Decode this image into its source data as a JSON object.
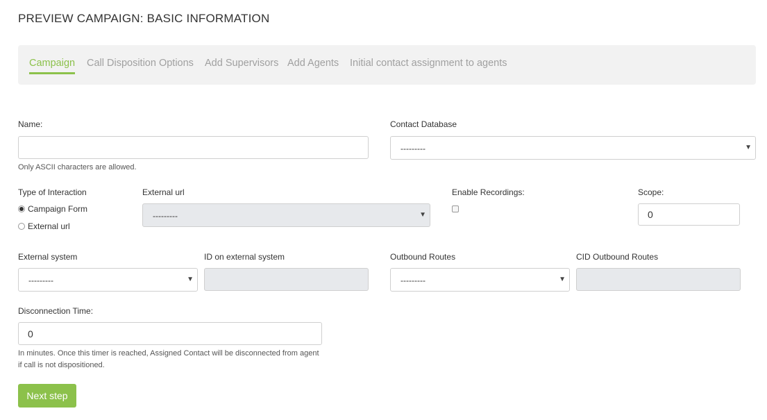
{
  "page": {
    "title": "PREVIEW CAMPAIGN: BASIC INFORMATION"
  },
  "tabs": [
    {
      "label": "Campaign",
      "active": true
    },
    {
      "label": "Call Disposition Options",
      "active": false
    },
    {
      "label": "Add Supervisors",
      "active": false
    },
    {
      "label": "Add Agents",
      "active": false
    },
    {
      "label": "Initial contact assignment to agents",
      "active": false
    }
  ],
  "form": {
    "name": {
      "label": "Name:",
      "value": "",
      "help": "Only ASCII characters are allowed."
    },
    "contact_database": {
      "label": "Contact Database",
      "value": "---------"
    },
    "type_of_interaction": {
      "label": "Type of Interaction",
      "options": [
        {
          "label": "Campaign Form",
          "checked": true
        },
        {
          "label": "External url",
          "checked": false
        }
      ]
    },
    "external_url": {
      "label": "External url",
      "value": "---------",
      "disabled": true
    },
    "enable_recordings": {
      "label": "Enable Recordings:",
      "checked": false
    },
    "scope": {
      "label": "Scope:",
      "value": "0"
    },
    "external_system": {
      "label": "External system",
      "value": "---------"
    },
    "id_external_system": {
      "label": "ID on external system",
      "value": "",
      "disabled": true
    },
    "outbound_routes": {
      "label": "Outbound Routes",
      "value": "---------"
    },
    "cid_outbound_routes": {
      "label": "CID Outbound Routes",
      "value": "",
      "disabled": true
    },
    "disconnection_time": {
      "label": "Disconnection Time:",
      "value": "0",
      "help": "In minutes. Once this timer is reached, Assigned Contact will be disconnected from agent if call is not dispositioned."
    }
  },
  "actions": {
    "next_label": "Next step"
  },
  "colors": {
    "accent": "#8cc14b",
    "tab_inactive": "#a0a0a0",
    "disabled_bg": "#e7e9ec",
    "tabbar_bg": "#f2f2f2"
  },
  "icons": {
    "select_caret": "caret-down-icon",
    "radio": "radio-icon",
    "checkbox": "checkbox-icon"
  }
}
